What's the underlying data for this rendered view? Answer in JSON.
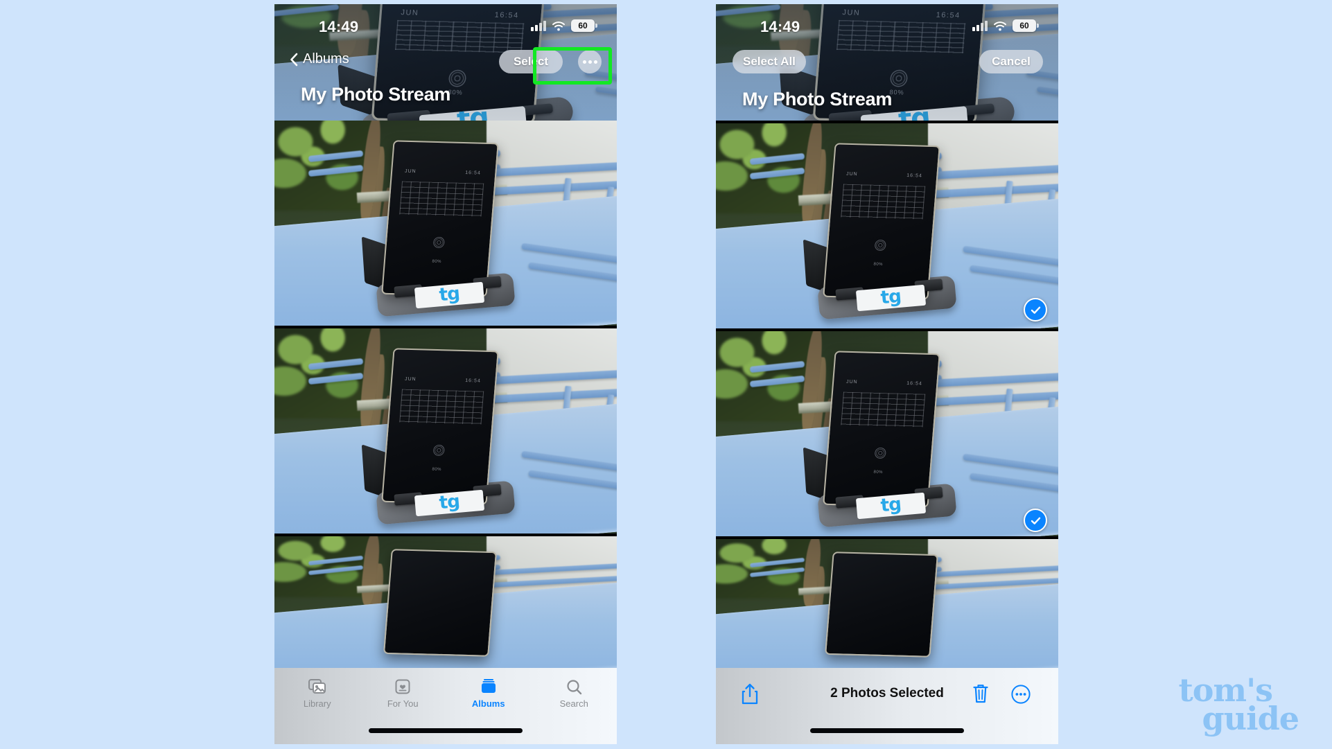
{
  "background_color": "#cfe4fc",
  "accent_color": "#0a84ff",
  "highlight_color": "#12e823",
  "panels": [
    {
      "id": "left",
      "statusbar": {
        "time": "14:49",
        "signal_icon": "cellular-signal-icon",
        "wifi_icon": "wifi-icon",
        "battery_icon": "battery-icon",
        "battery_level": "60"
      },
      "nav": {
        "back_icon": "chevron-left-icon",
        "back_label": "Albums",
        "select_label": "Select",
        "more_icon": "ellipsis-icon"
      },
      "title": "My Photo Stream",
      "highlight_target": "select-button",
      "tabbar": [
        {
          "label": "Library",
          "icon": "photo-stack-icon",
          "active": false
        },
        {
          "label": "For You",
          "icon": "heart-card-icon",
          "active": false
        },
        {
          "label": "Albums",
          "icon": "albums-icon",
          "active": true
        },
        {
          "label": "Search",
          "icon": "search-icon",
          "active": false
        }
      ],
      "home_indicator": true
    },
    {
      "id": "right",
      "statusbar": {
        "time": "14:49",
        "signal_icon": "cellular-signal-icon",
        "wifi_icon": "wifi-icon",
        "battery_icon": "battery-icon",
        "battery_level": "60"
      },
      "nav": {
        "select_all_label": "Select All",
        "cancel_label": "Cancel"
      },
      "title": "My Photo Stream",
      "selection": {
        "photo_1_selected": true,
        "photo_2_selected": true,
        "check_icon": "checkmark-circle-icon"
      },
      "actionbar": {
        "share_icon": "share-icon",
        "status_text": "2 Photos Selected",
        "trash_icon": "trash-icon",
        "more_icon": "ellipsis-circle-icon"
      },
      "home_indicator": true
    }
  ],
  "photo_scene": {
    "device_calendar_month": "JUN",
    "device_clock": "16:54",
    "device_battery": "80%",
    "stand_logo": "tg"
  },
  "watermark": {
    "line1": "tom's",
    "line2": "guide"
  }
}
